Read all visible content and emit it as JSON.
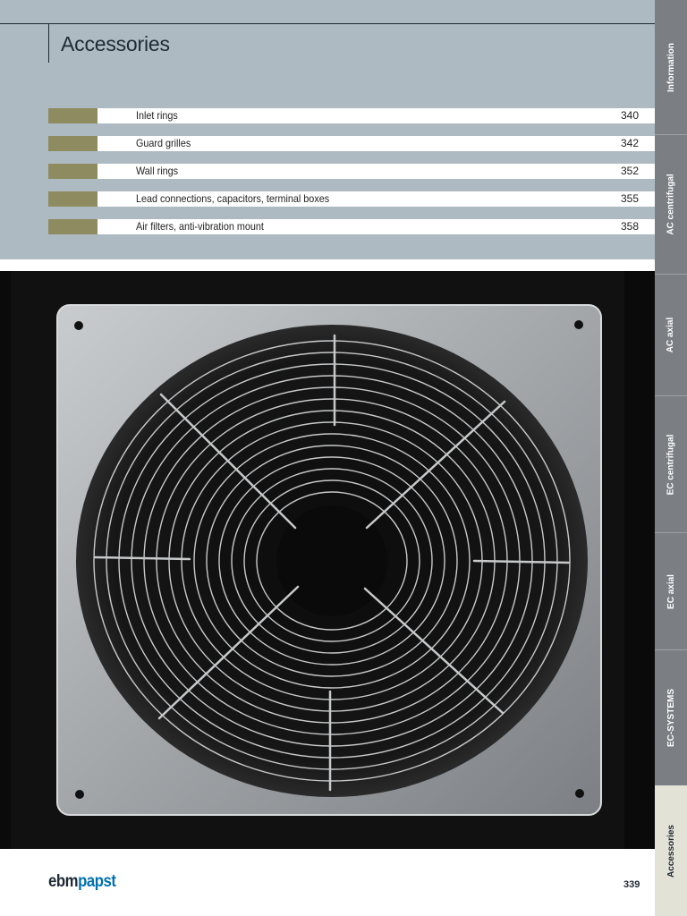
{
  "header": {
    "title": "Accessories"
  },
  "toc": [
    {
      "label": "Inlet rings",
      "page": "340"
    },
    {
      "label": "Guard grilles",
      "page": "342"
    },
    {
      "label": "Wall rings",
      "page": "352"
    },
    {
      "label": "Lead connections, capacitors, terminal boxes",
      "page": "355"
    },
    {
      "label": "Air filters, anti-vibration mount",
      "page": "358"
    }
  ],
  "sidebar": {
    "tabs": [
      {
        "label": "Information"
      },
      {
        "label": "AC centrifugal"
      },
      {
        "label": "AC axial"
      },
      {
        "label": "EC centrifugal"
      },
      {
        "label": "EC axial"
      },
      {
        "label": "EC-SYSTEMS"
      },
      {
        "label": "Accessories",
        "active": true
      }
    ]
  },
  "footer": {
    "logo_part1": "ebm",
    "logo_part2": "papst",
    "page_number": "339"
  },
  "colors": {
    "header_band": "#aebac1",
    "swatch": "#8e8b61",
    "sidebar": "#7b7e83",
    "sidebar_active": "#e3e2d6",
    "brand_blue": "#0070b0"
  }
}
